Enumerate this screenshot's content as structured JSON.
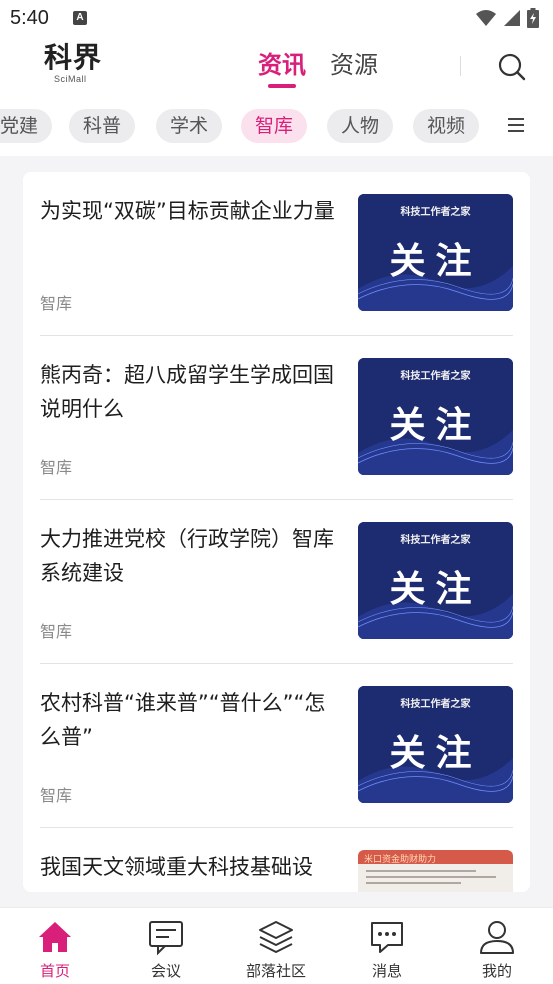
{
  "status": {
    "time": "5:40",
    "a_badge": "A"
  },
  "header": {
    "logo_main": "科界",
    "logo_sub": "SciMall",
    "tabs": [
      {
        "label": "资讯",
        "active": true
      },
      {
        "label": "资源",
        "active": false
      }
    ],
    "accent_color": "#d8207a",
    "search_icon": "search-icon"
  },
  "chips": [
    {
      "label": "党建",
      "active": false
    },
    {
      "label": "科普",
      "active": false
    },
    {
      "label": "学术",
      "active": false
    },
    {
      "label": "智库",
      "active": true
    },
    {
      "label": "人物",
      "active": false
    },
    {
      "label": "视频",
      "active": false
    }
  ],
  "thumbnail": {
    "top_text": "科技工作者之家",
    "big_text": "关注"
  },
  "doc_thumbnail": {
    "header_text": "米口资金助财助力"
  },
  "articles": [
    {
      "title": "为实现“双碳”目标贡献企业力量",
      "tag": "智库",
      "thumb": "guanzhu"
    },
    {
      "title": "熊丙奇：超八成留学生学成回国说明什么",
      "tag": "智库",
      "thumb": "guanzhu"
    },
    {
      "title": "大力推进党校（行政学院）智库系统建设",
      "tag": "智库",
      "thumb": "guanzhu"
    },
    {
      "title": "农村科普“谁来普”“普什么”“怎么普”",
      "tag": "智库",
      "thumb": "guanzhu"
    },
    {
      "title": "我国天文领域重大科技基础设",
      "tag": "",
      "thumb": "document"
    }
  ],
  "bottom_nav": [
    {
      "label": "首页",
      "icon": "home-icon",
      "active": true
    },
    {
      "label": "会议",
      "icon": "meeting-icon",
      "active": false
    },
    {
      "label": "部落社区",
      "icon": "layers-icon",
      "active": false
    },
    {
      "label": "消息",
      "icon": "message-icon",
      "active": false
    },
    {
      "label": "我的",
      "icon": "person-icon",
      "active": false
    }
  ]
}
